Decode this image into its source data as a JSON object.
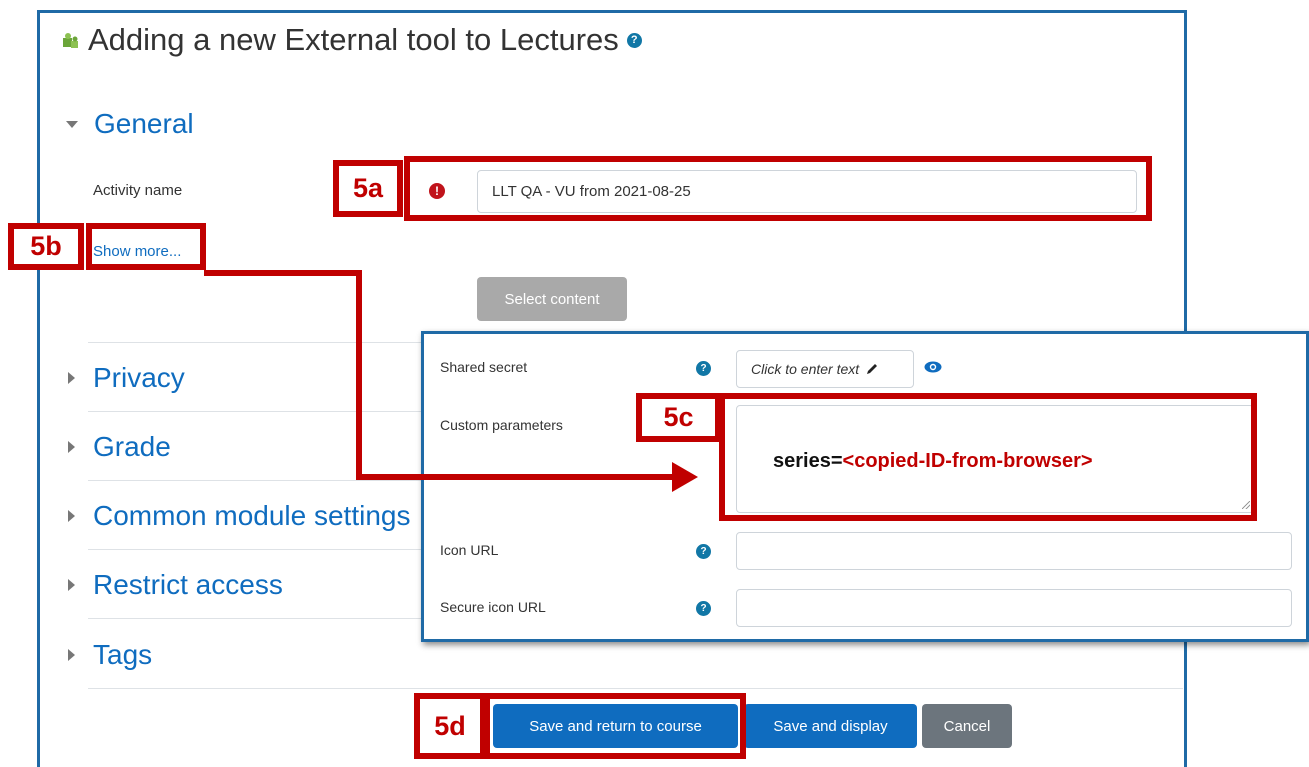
{
  "page": {
    "title": "Adding a new External tool to Lectures",
    "help_glyph": "?"
  },
  "general": {
    "section_label": "General",
    "activity_name_label": "Activity name",
    "activity_name_value": "LLT QA - VU from 2021-08-25",
    "required_glyph": "!",
    "show_more_link": "Show more...",
    "select_content_button": "Select content"
  },
  "sections": [
    "Privacy",
    "Grade",
    "Common module settings",
    "Restrict access",
    "Tags"
  ],
  "panel": {
    "shared_secret_label": "Shared secret",
    "shared_secret_placeholder": "Click to enter text",
    "custom_parameters_label": "Custom parameters",
    "custom_parameters_key": "series=",
    "custom_parameters_value": "<copied-ID-from-browser>",
    "icon_url_label": "Icon URL",
    "secure_icon_url_label": "Secure icon URL",
    "help_glyph": "?"
  },
  "buttons": {
    "save_return": "Save and return to course",
    "save_display": "Save and display",
    "cancel": "Cancel"
  },
  "annotations": {
    "tag_5a": "5a",
    "tag_5b": "5b",
    "tag_5c": "5c",
    "tag_5d": "5d"
  },
  "colors": {
    "annotation_red": "#c00000",
    "link_blue": "#0f6cbf",
    "frame_blue": "#1f6aa6"
  }
}
